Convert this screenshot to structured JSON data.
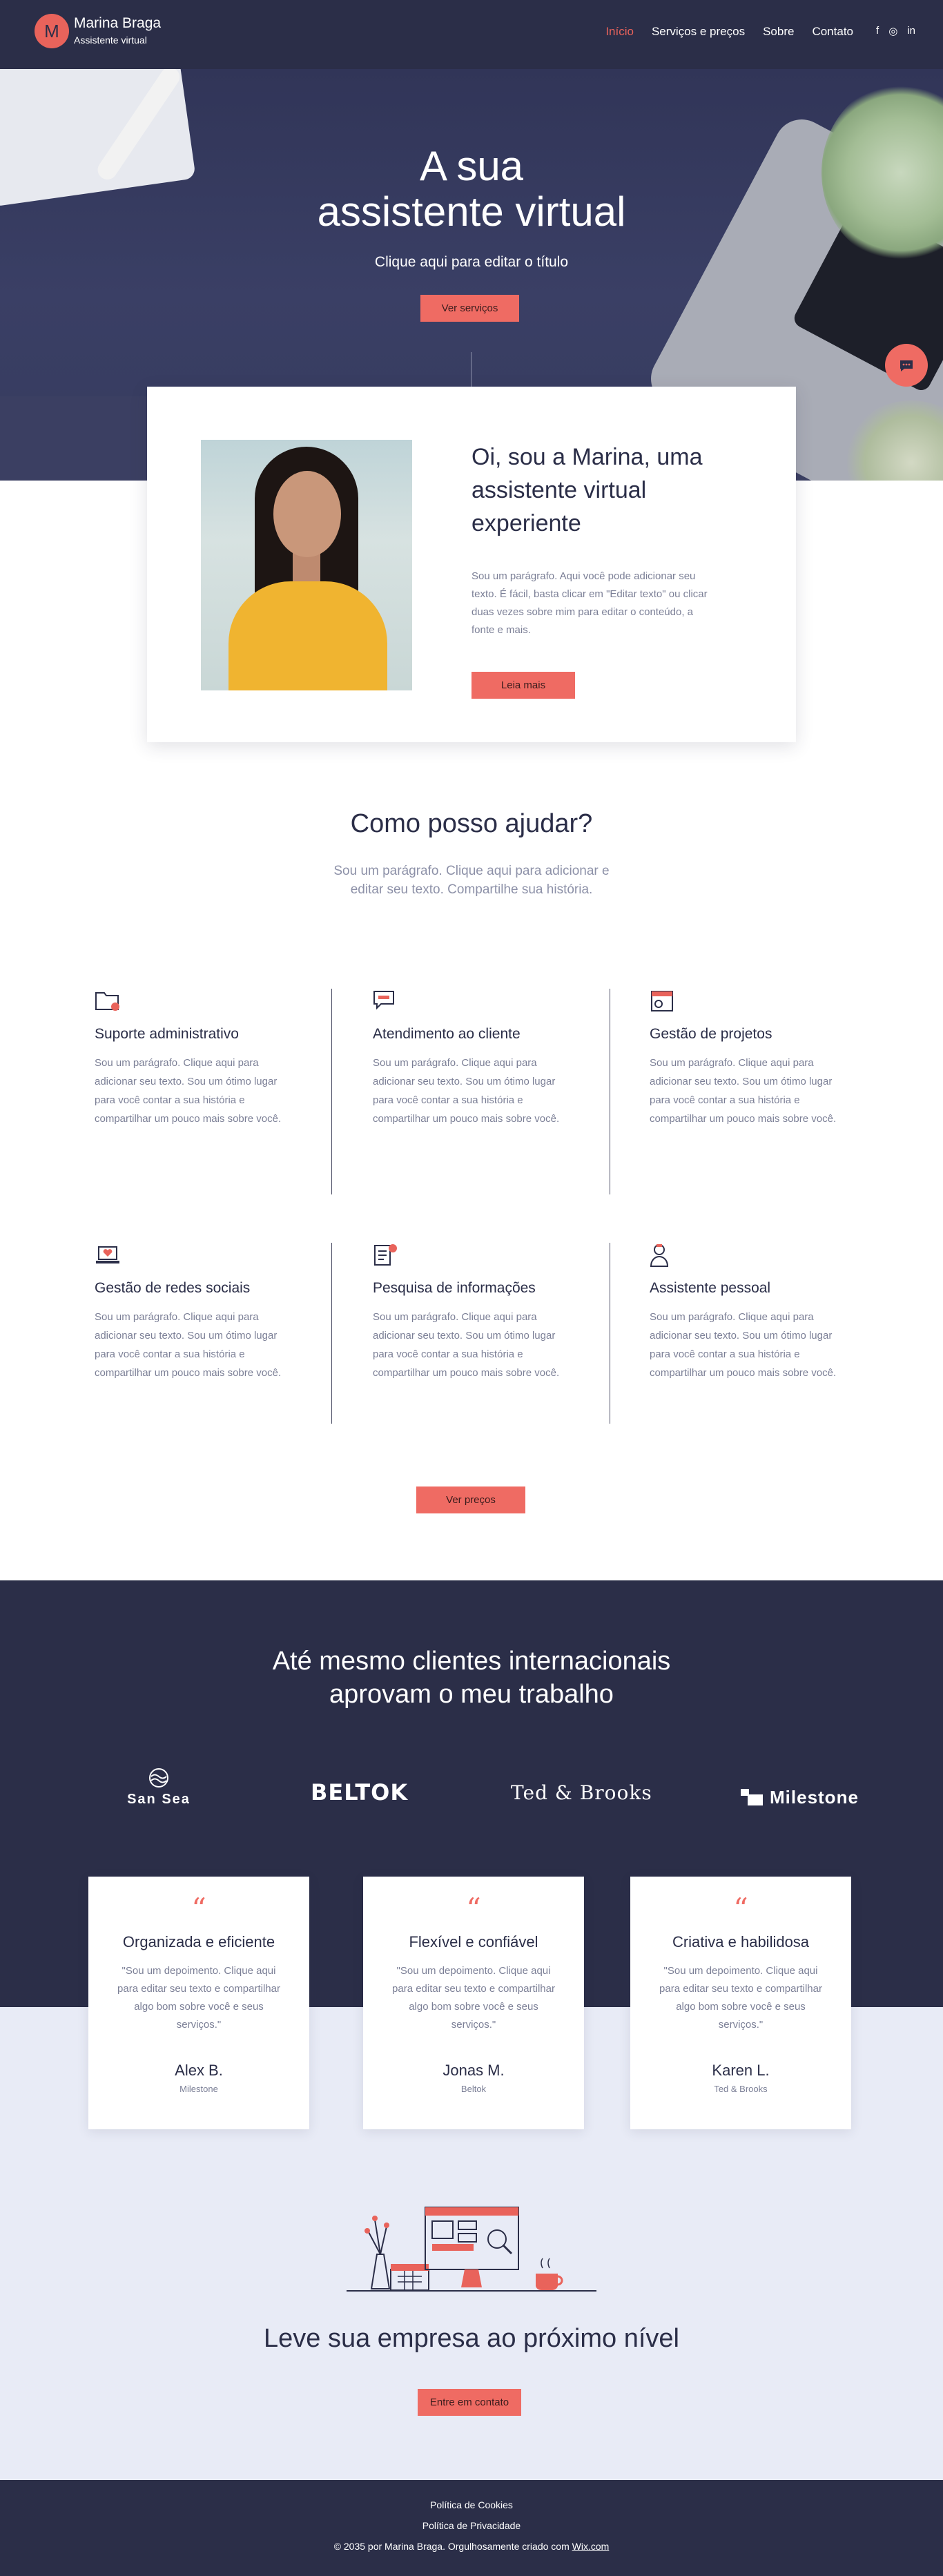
{
  "header": {
    "logo_letter": "M",
    "brand_name": "Marina Braga",
    "brand_sub": "Assistente virtual",
    "nav": [
      "Início",
      "Serviços e preços",
      "Sobre",
      "Contato"
    ],
    "socials": [
      "f",
      "◎",
      "in"
    ],
    "accent_color": "#e9635b",
    "bg_color": "#2b2e48"
  },
  "hero": {
    "title_line1": "A sua",
    "title_line2": "assistente virtual",
    "subtitle": "Clique aqui para editar o título",
    "button": "Ver serviços",
    "chat_icon": "chat-icon"
  },
  "about": {
    "title": "Oi, sou a Marina, uma assistente virtual experiente",
    "text": "Sou um parágrafo. Aqui você pode adicionar seu texto. É fácil, basta clicar em \"Editar texto\" ou clicar duas vezes sobre mim para editar o conteúdo, a fonte e mais.",
    "button": "Leia mais"
  },
  "services": {
    "title": "Como posso ajudar?",
    "subtitle": "Sou um parágrafo. Clique aqui para adicionar e editar seu texto. Compartilhe sua história.",
    "items": [
      {
        "icon": "folder-icon",
        "title": "Suporte administrativo",
        "text": "Sou um parágrafo. Clique aqui para adicionar seu texto. Sou um ótimo lugar para você contar a sua história e compartilhar um pouco mais sobre você."
      },
      {
        "icon": "chat-bubbles-icon",
        "title": "Atendimento ao cliente",
        "text": "Sou um parágrafo. Clique aqui para adicionar seu texto. Sou um ótimo lugar para você contar a sua história e compartilhar um pouco mais sobre você."
      },
      {
        "icon": "calendar-icon",
        "title": "Gestão de projetos",
        "text": "Sou um parágrafo. Clique aqui para adicionar seu texto. Sou um ótimo lugar para você contar a sua história e compartilhar um pouco mais sobre você."
      },
      {
        "icon": "laptop-heart-icon",
        "title": "Gestão de redes sociais",
        "text": "Sou um parágrafo. Clique aqui para adicionar seu texto. Sou um ótimo lugar para você contar a sua história e compartilhar um pouco mais sobre você."
      },
      {
        "icon": "document-search-icon",
        "title": "Pesquisa de informações",
        "text": "Sou um parágrafo. Clique aqui para adicionar seu texto. Sou um ótimo lugar para você contar a sua história e compartilhar um pouco mais sobre você."
      },
      {
        "icon": "assistant-person-icon",
        "title": "Assistente pessoal",
        "text": "Sou um parágrafo. Clique aqui para adicionar seu texto. Sou um ótimo lugar para você contar a sua história e compartilhar um pouco mais sobre você."
      }
    ],
    "button": "Ver preços"
  },
  "clients": {
    "title_line1": "Até mesmo clientes internacionais",
    "title_line2": "aprovam o meu trabalho",
    "logos": [
      "San Sea",
      "BELTOK",
      "Ted & Brooks",
      "Milestone"
    ]
  },
  "testimonials": [
    {
      "title": "Organizada e eficiente",
      "text": "\"Sou um depoimento. Clique aqui para editar seu texto e compartilhar algo bom sobre você e seus serviços.\"",
      "name": "Alex B.",
      "company": "Milestone"
    },
    {
      "title": "Flexível e confiável",
      "text": "\"Sou um depoimento. Clique aqui para editar seu texto e compartilhar algo bom sobre você e seus serviços.\"",
      "name": "Jonas M.",
      "company": "Beltok"
    },
    {
      "title": "Criativa e habilidosa",
      "text": "\"Sou um depoimento. Clique aqui para editar seu texto e compartilhar algo bom sobre você e seus serviços.\"",
      "name": "Karen L.",
      "company": "Ted & Brooks"
    }
  ],
  "quote_glyph": "“",
  "cta": {
    "title": "Leve sua empresa ao próximo nível",
    "button": "Entre em contato"
  },
  "footer": {
    "cookies": "Política de Cookies",
    "privacy": "Política de Privacidade",
    "copyright_prefix": "© 2035 por Marina Braga. Orgulhosamente criado com ",
    "wix": "Wix.com"
  }
}
